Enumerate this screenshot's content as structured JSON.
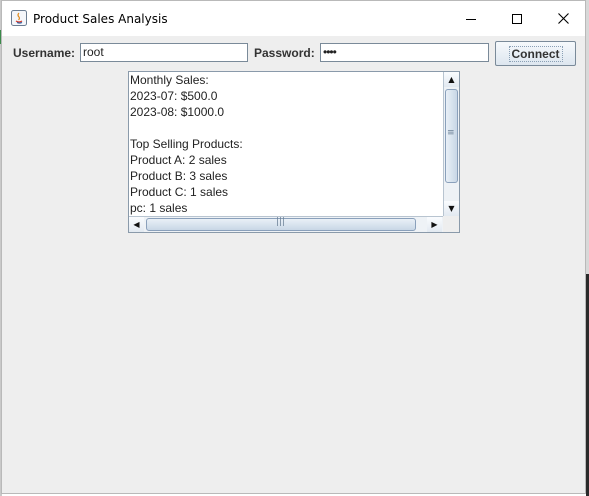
{
  "window": {
    "title": "Product Sales Analysis"
  },
  "form": {
    "username_label": "Username:",
    "username_value": "root",
    "password_label": "Password:",
    "password_value": "••••",
    "connect_label": "Connect"
  },
  "output": {
    "lines": [
      "Monthly Sales:",
      "2023-07: $500.0",
      "2023-08: $1000.0",
      "",
      "Top Selling Products:",
      "Product A: 2 sales",
      "Product B: 3 sales",
      "Product C: 1 sales",
      "pc: 1 sales"
    ]
  },
  "icons": [
    "java-app-icon",
    "minimize-icon",
    "maximize-icon",
    "close-icon",
    "scroll-up-icon",
    "scroll-down-icon",
    "scroll-left-icon",
    "scroll-right-icon"
  ]
}
